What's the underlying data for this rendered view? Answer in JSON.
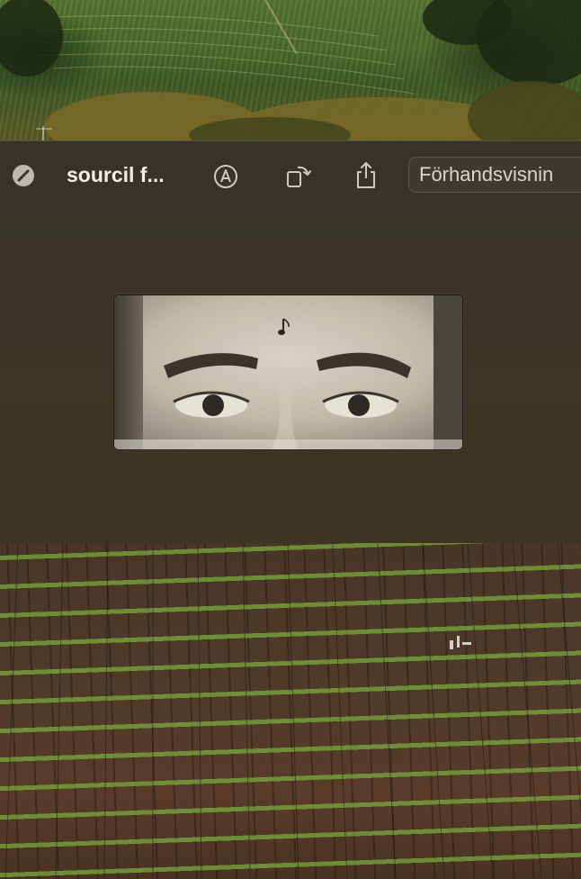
{
  "window": {
    "title": "sourcil f...",
    "app_name": "Förhandsvisnin"
  },
  "toolbar": {
    "icons": [
      "slash-circle-icon",
      "markup-icon",
      "rotate-icon",
      "share-icon"
    ]
  },
  "document": {
    "content": "photo-crop-eyes-and-eyebrows"
  },
  "wallpaper": {
    "content": "vineyard-landscape"
  }
}
